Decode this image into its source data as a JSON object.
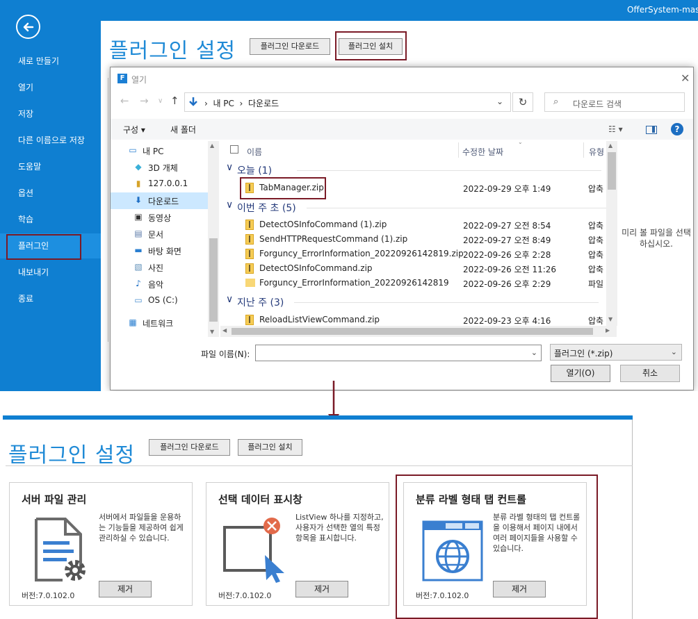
{
  "window_title": "OfferSystem-maste",
  "sidebar": {
    "items": [
      "새로 만들기",
      "열기",
      "저장",
      "다른 이름으로 저장",
      "도움말",
      "옵션",
      "학습",
      "플러그인",
      "내보내기",
      "종료"
    ]
  },
  "backstage": {
    "title": "플러그인 설정",
    "download_label": "플러그인 다운로드",
    "install_label": "플러그인 설치"
  },
  "dialog": {
    "title": "열기",
    "breadcrumb": [
      "내 PC",
      "다운로드"
    ],
    "search_placeholder": "다운로드 검색",
    "organize_label": "구성",
    "new_folder_label": "새 폴더",
    "tree": [
      {
        "label": "내 PC",
        "icon": "computer-icon"
      },
      {
        "label": "3D 개체",
        "icon": "cube-icon"
      },
      {
        "label": "127.0.0.1",
        "icon": "network-drive-icon"
      },
      {
        "label": "다운로드",
        "icon": "download-icon"
      },
      {
        "label": "동영상",
        "icon": "video-icon"
      },
      {
        "label": "문서",
        "icon": "document-icon"
      },
      {
        "label": "바탕 화면",
        "icon": "desktop-icon"
      },
      {
        "label": "사진",
        "icon": "picture-icon"
      },
      {
        "label": "음악",
        "icon": "music-icon"
      },
      {
        "label": "OS (C:)",
        "icon": "drive-icon"
      },
      {
        "label": "네트워크",
        "icon": "network-icon"
      }
    ],
    "columns": {
      "name": "이름",
      "date": "수정한 날짜",
      "type": "유형"
    },
    "groups": [
      {
        "label": "오늘 (1)"
      },
      {
        "label": "이번 주 초 (5)"
      },
      {
        "label": "지난 주 (3)"
      }
    ],
    "files": [
      {
        "name": "TabManager.zip",
        "date": "2022-09-29 오후 1:49",
        "type": "압축"
      },
      {
        "name": "DetectOSInfoCommand (1).zip",
        "date": "2022-09-27 오전 8:54",
        "type": "압축"
      },
      {
        "name": "SendHTTPRequestCommand (1).zip",
        "date": "2022-09-27 오전 8:49",
        "type": "압축"
      },
      {
        "name": "Forguncy_ErrorInformation_20220926142819.zip",
        "date": "2022-09-26 오후 2:28",
        "type": "압축"
      },
      {
        "name": "DetectOSInfoCommand.zip",
        "date": "2022-09-26 오전 11:26",
        "type": "압축"
      },
      {
        "name": "Forguncy_ErrorInformation_20220926142819",
        "date": "2022-09-26 오후 2:29",
        "type": "파일"
      },
      {
        "name": "ReloadListViewCommand.zip",
        "date": "2022-09-23 오후 4:16",
        "type": "압축"
      }
    ],
    "preview_text": "미리 볼 파일을 선택하십시오.",
    "filename_label": "파일 이름(N):",
    "filename_value": "",
    "filetype_value": "플러그인 (*.zip)",
    "open_label": "열기(O)",
    "cancel_label": "취소"
  },
  "installed": {
    "title": "플러그인 설정",
    "download_label": "플러그인 다운로드",
    "install_label": "플러그인 설치",
    "cards": [
      {
        "title": "서버 파일 관리",
        "desc": "서버에서 파일들을 운용하는 기능들을 제공하여 쉽게 관리하실 수 있습니다.",
        "version": "버전:7.0.102.0",
        "remove": "제거"
      },
      {
        "title": "선택 데이터 표시창",
        "desc": "ListView 하나를 지정하고, 사용자가 선택한 열의 특정 항목을 표시합니다.",
        "version": "버전:7.0.102.0",
        "remove": "제거"
      },
      {
        "title": "분류 라벨 형태 탭 컨트롤",
        "desc": "분류 라벨 형태의 탭 컨트롤을 이용해서 페이지 내에서 여러 페이지들을 사용할 수 있습니다.",
        "version": "버전:7.0.102.0",
        "remove": "제거"
      }
    ]
  },
  "colors": {
    "accent": "#0f7fd1",
    "title_blue": "#1f8ad6",
    "highlight_box": "#7a1a26"
  }
}
